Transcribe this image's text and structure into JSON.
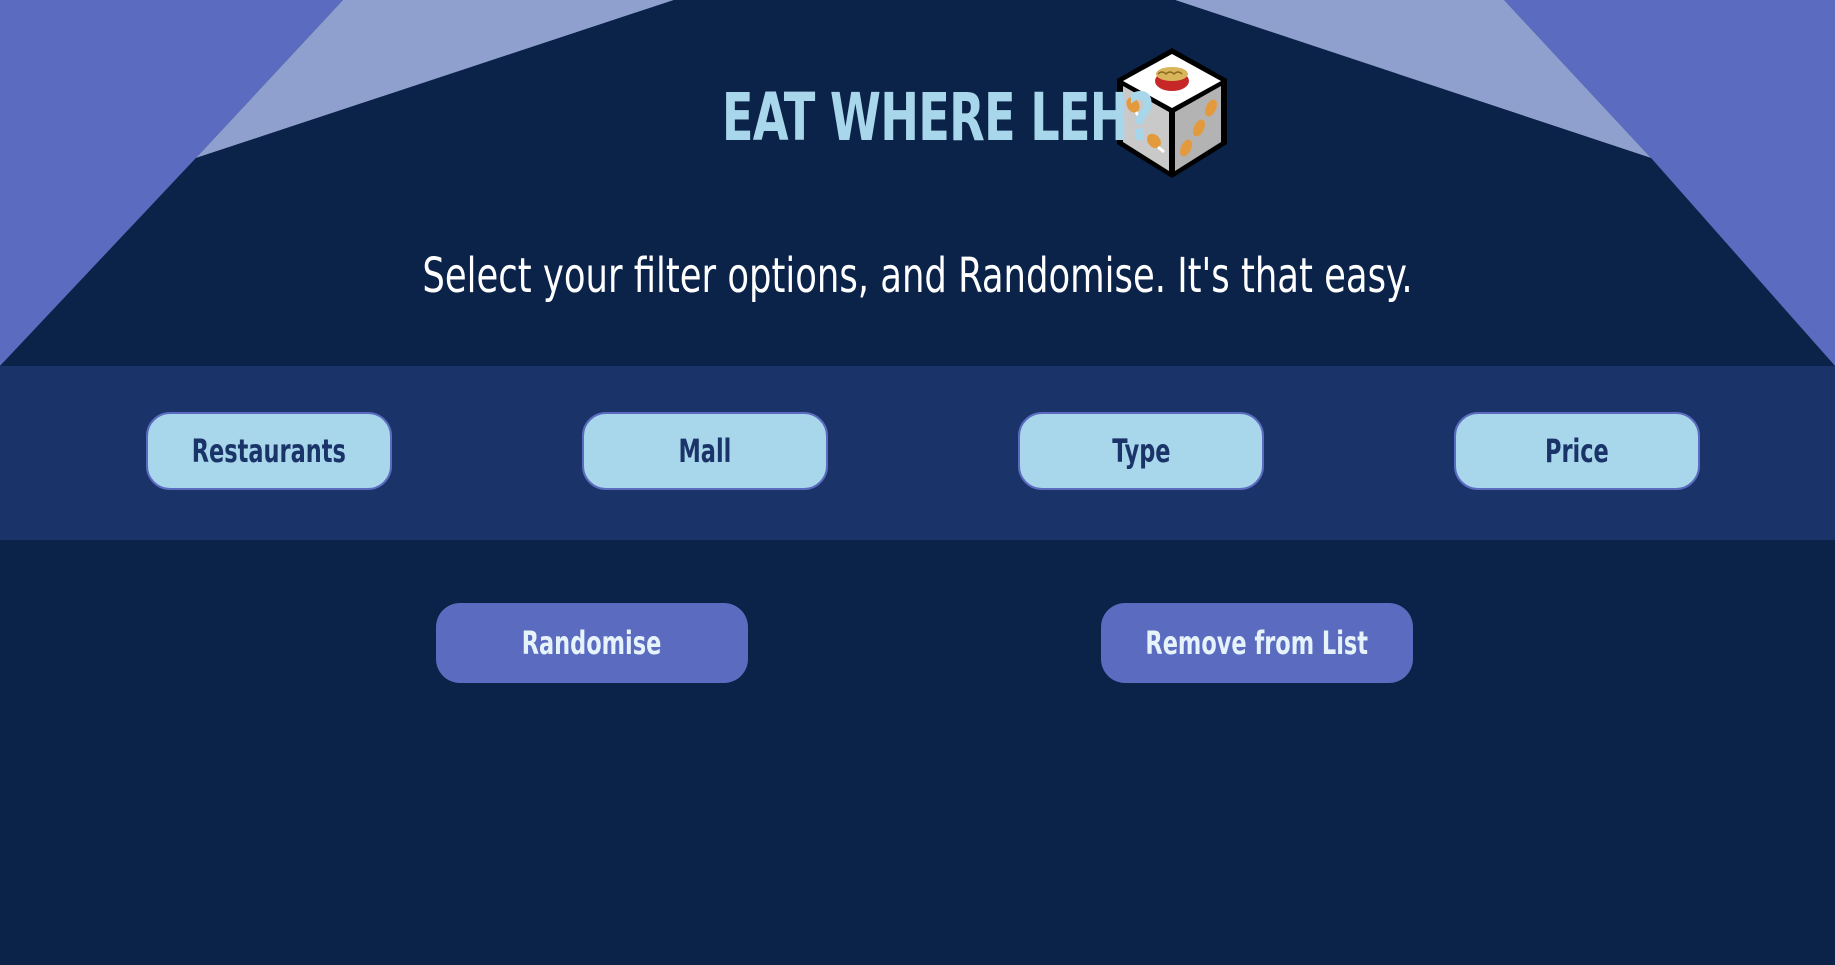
{
  "header": {
    "title": "EAT WHERE LEH?",
    "logo_icon": "food-dice-icon",
    "tagline": "Select your filter options, and Randomise. It's that easy."
  },
  "filters": [
    {
      "label": "Restaurants"
    },
    {
      "label": "Mall"
    },
    {
      "label": "Type"
    },
    {
      "label": "Price"
    }
  ],
  "actions": {
    "randomise_label": "Randomise",
    "remove_label": "Remove from List"
  },
  "colors": {
    "background": "#0b2249",
    "filter_bar": "#1a3469",
    "accent_light": "#a8d6ea",
    "accent_blue": "#5b6cc0",
    "accent_pale": "#8fa0cf"
  }
}
